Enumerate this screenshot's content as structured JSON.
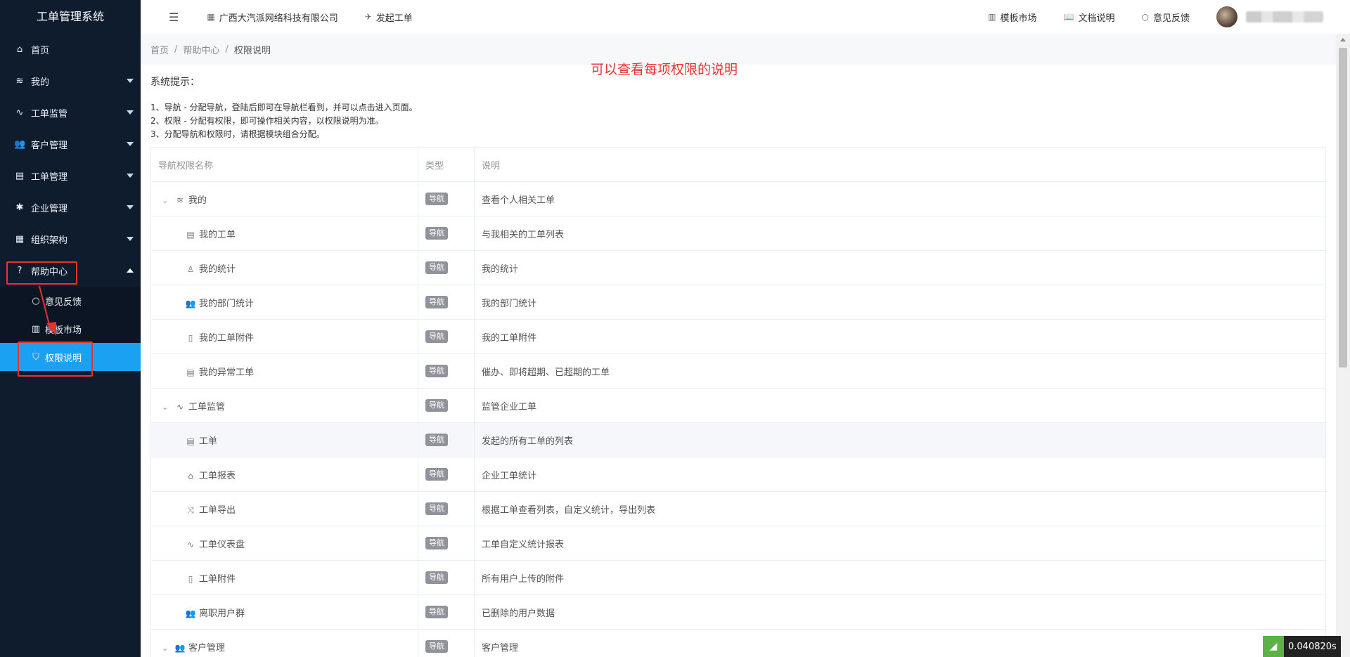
{
  "sidebar": {
    "brand": "工单管理系统",
    "items": [
      {
        "label": "首页",
        "icon": "home-icon",
        "glyph": "⌂",
        "caret": ""
      },
      {
        "label": "我的",
        "icon": "layers-icon",
        "glyph": "≋",
        "caret": "down"
      },
      {
        "label": "工单监管",
        "icon": "pulse-icon",
        "glyph": "∿",
        "caret": "down"
      },
      {
        "label": "客户管理",
        "icon": "users-icon",
        "glyph": "👥",
        "caret": "down"
      },
      {
        "label": "工单管理",
        "icon": "clipboard-icon",
        "glyph": "▤",
        "caret": "down"
      },
      {
        "label": "企业管理",
        "icon": "gear-icon",
        "glyph": "✱",
        "caret": "down"
      },
      {
        "label": "组织架构",
        "icon": "calendar-icon",
        "glyph": "▦",
        "caret": "down"
      },
      {
        "label": "帮助中心",
        "icon": "question-icon",
        "glyph": "?",
        "caret": "up"
      }
    ],
    "sub_items": [
      {
        "label": "意见反馈",
        "icon": "circle-icon",
        "glyph": "○"
      },
      {
        "label": "模板市场",
        "icon": "book-icon",
        "glyph": "▥"
      },
      {
        "label": "权限说明",
        "icon": "shield-icon",
        "glyph": "⛉"
      }
    ]
  },
  "topbar": {
    "company": "广西大汽派网络科技有限公司",
    "create_order": "发起工单",
    "template_market": "模板市场",
    "docs": "文档说明",
    "feedback": "意见反馈"
  },
  "breadcrumb": {
    "home": "首页",
    "help": "帮助中心",
    "current": "权限说明"
  },
  "annotation": "可以查看每项权限的说明",
  "tips": {
    "title": "系统提示：",
    "lines": [
      "1、导航 - 分配导航，登陆后即可在导航栏看到，并可以点击进入页面。",
      "2、权限 - 分配有权限，即可操作相关内容，以权限说明为准。",
      "3、分配导航和权限时，请根据模块组合分配。"
    ]
  },
  "table": {
    "headers": [
      "导航权限名称",
      "类型",
      "说明"
    ],
    "rows": [
      {
        "name": "我的",
        "type": "导航",
        "desc": "查看个人相关工单",
        "level": 0,
        "icon": "layers-icon",
        "glyph": "≋"
      },
      {
        "name": "我的工单",
        "type": "导航",
        "desc": "与我相关的工单列表",
        "level": 1,
        "icon": "doc-lines-icon",
        "glyph": "▤"
      },
      {
        "name": "我的统计",
        "type": "导航",
        "desc": "我的统计",
        "level": 1,
        "icon": "user-icon",
        "glyph": "♙"
      },
      {
        "name": "我的部门统计",
        "type": "导航",
        "desc": "我的部门统计",
        "level": 1,
        "icon": "users-icon",
        "glyph": "👥"
      },
      {
        "name": "我的工单附件",
        "type": "导航",
        "desc": "我的工单附件",
        "level": 1,
        "icon": "file-icon",
        "glyph": "▯"
      },
      {
        "name": "我的异常工单",
        "type": "导航",
        "desc": "催办、即将超期、已超期的工单",
        "level": 1,
        "icon": "doc-lines-icon",
        "glyph": "▤"
      },
      {
        "name": "工单监管",
        "type": "导航",
        "desc": "监管企业工单",
        "level": 0,
        "icon": "pulse-icon",
        "glyph": "∿"
      },
      {
        "name": "工单",
        "type": "导航",
        "desc": "发起的所有工单的列表",
        "level": 1,
        "icon": "doc-lines-icon",
        "glyph": "▤"
      },
      {
        "name": "工单报表",
        "type": "导航",
        "desc": "企业工单统计",
        "level": 1,
        "icon": "home-icon",
        "glyph": "⌂"
      },
      {
        "name": "工单导出",
        "type": "导航",
        "desc": "根据工单查看列表，自定义统计，导出列表",
        "level": 1,
        "icon": "shuffle-icon",
        "glyph": "⤨"
      },
      {
        "name": "工单仪表盘",
        "type": "导航",
        "desc": "工单自定义统计报表",
        "level": 1,
        "icon": "pulse-icon",
        "glyph": "∿"
      },
      {
        "name": "工单附件",
        "type": "导航",
        "desc": "所有用户上传的附件",
        "level": 1,
        "icon": "file-icon",
        "glyph": "▯"
      },
      {
        "name": "离职用户群",
        "type": "导航",
        "desc": "已删除的用户数据",
        "level": 1,
        "icon": "users-icon",
        "glyph": "👥"
      },
      {
        "name": "客户管理",
        "type": "导航",
        "desc": "客户管理",
        "level": 0,
        "icon": "users-icon",
        "glyph": "👥"
      }
    ]
  },
  "perf": {
    "value": "0.040820s"
  },
  "colors": {
    "sidebar_bg": "#0f1c2e",
    "active_item": "#1aa1f2",
    "annotation_red": "#e6332f",
    "tag_gray": "#909399"
  }
}
